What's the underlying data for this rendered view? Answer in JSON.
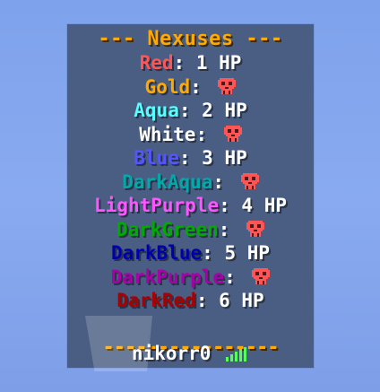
{
  "title": "--- Nexuses ---",
  "separator": ":",
  "rows": [
    {
      "team": "Red",
      "color": "#ff5555",
      "value": "1 HP",
      "status": "alive"
    },
    {
      "team": "Gold",
      "color": "#ffaa00",
      "value": "",
      "status": "destroyed",
      "icon": "skull-icon"
    },
    {
      "team": "Aqua",
      "color": "#55ffff",
      "value": "2 HP",
      "status": "alive"
    },
    {
      "team": "White",
      "color": "#ffffff",
      "value": "",
      "status": "destroyed",
      "icon": "skull-icon"
    },
    {
      "team": "Blue",
      "color": "#5555ff",
      "value": "3 HP",
      "status": "alive"
    },
    {
      "team": "DarkAqua",
      "color": "#00aaaa",
      "value": "",
      "status": "destroyed",
      "icon": "skull-icon"
    },
    {
      "team": "LightPurple",
      "color": "#ff55ff",
      "value": "4 HP",
      "status": "alive"
    },
    {
      "team": "DarkGreen",
      "color": "#00aa00",
      "value": "",
      "status": "destroyed",
      "icon": "skull-icon"
    },
    {
      "team": "DarkBlue",
      "color": "#0000aa",
      "value": "5 HP",
      "status": "alive"
    },
    {
      "team": "DarkPurple",
      "color": "#aa00aa",
      "value": "",
      "status": "destroyed",
      "icon": "skull-icon"
    },
    {
      "team": "DarkRed",
      "color": "#aa0000",
      "value": "6 HP",
      "status": "alive"
    }
  ],
  "footer_rule": "----------------",
  "player": {
    "name": "nikorr0",
    "ping_icon": "signal-bars-icon",
    "ping_color": "#55ff55"
  },
  "skull_color": "#ff5555"
}
